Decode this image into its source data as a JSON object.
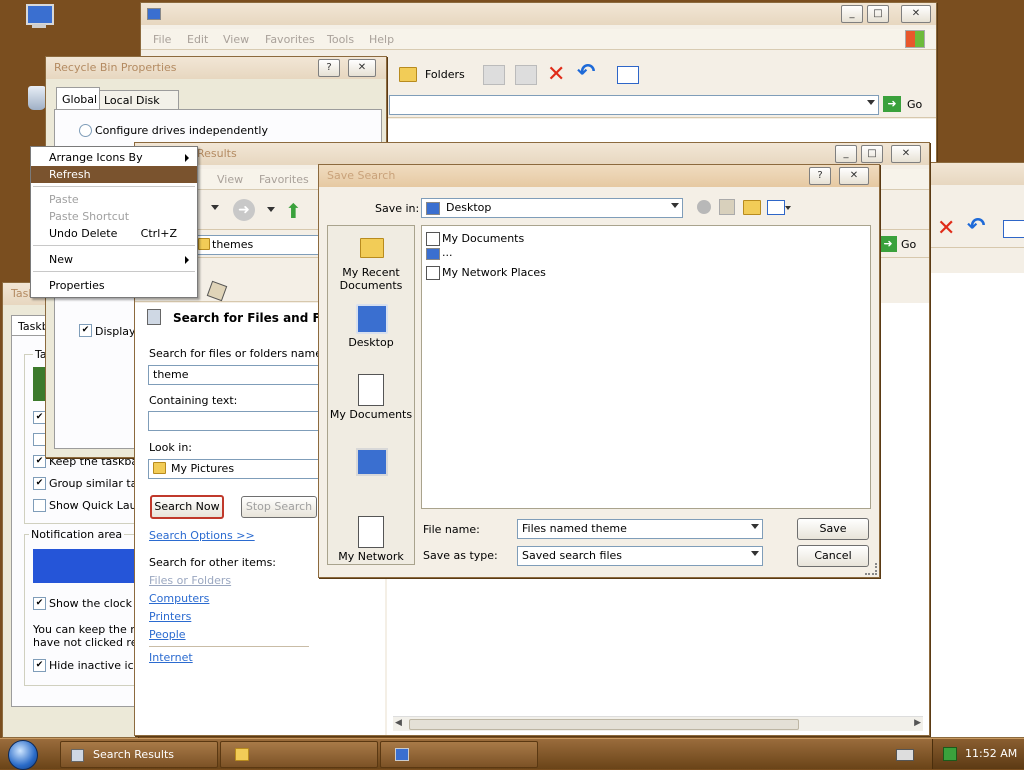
{
  "colors": {
    "desktop": "#7a4e1f",
    "accent": "#7a532e"
  },
  "explorer_back": {
    "menu": [
      "File",
      "Edit",
      "View",
      "Favorites",
      "Tools",
      "Help"
    ],
    "toolbar_folders": "Folders",
    "go": "Go"
  },
  "recycle": {
    "title": "Recycle Bin Properties",
    "tabs": [
      "Global",
      "Local Disk (C:)"
    ],
    "option": "Configure drives independently",
    "display_chk": "Display d"
  },
  "context_menu": {
    "items": [
      "Arrange Icons By",
      "Refresh",
      "Paste",
      "Paste Shortcut",
      "Undo Delete",
      "New",
      "Properties"
    ],
    "undo_shortcut": "Ctrl+Z"
  },
  "taskbar_props": {
    "title": "Taskb",
    "tab": "Taskb",
    "group": "Ta",
    "items": [
      "Keep the taskbar",
      "Group similar task",
      "Show Quick Laun"
    ],
    "notification": "Notification area",
    "clock": "Show the clock",
    "desc_1": "You can keep the no",
    "desc_2": "have not clicked rece",
    "hide": "Hide inactive icon"
  },
  "search_window": {
    "title": "Results",
    "menu": [
      "View",
      "Favorites"
    ],
    "address": "themes",
    "heading": "Search for Files and Folde",
    "named_label": "Search for files or folders named:",
    "named_value": "theme",
    "containing_label": "Containing text:",
    "lookin_label": "Look in:",
    "lookin_value": "My Pictures",
    "search_now": "Search Now",
    "stop_search": "Stop Search",
    "options_link": "Search Options >>",
    "other_label": "Search for other items:",
    "other_links": [
      "Files or Folders",
      "Computers",
      "Printers",
      "People"
    ],
    "internet": "Internet",
    "go": "Go"
  },
  "save_dialog": {
    "title": "Save Search",
    "save_in_label": "Save in:",
    "save_in_value": "Desktop",
    "places": [
      "My Recent Documents",
      "Desktop",
      "My Documents",
      "",
      "My Network"
    ],
    "files": [
      "My Documents",
      "...",
      "My Network Places"
    ],
    "filename_label": "File name:",
    "filename_value": "Files named theme",
    "type_label": "Save as type:",
    "type_value": "Saved search files",
    "save": "Save",
    "cancel": "Cancel"
  },
  "taskbar": {
    "buttons": [
      "Search Results",
      "",
      ""
    ],
    "clock": "11:52 AM"
  }
}
